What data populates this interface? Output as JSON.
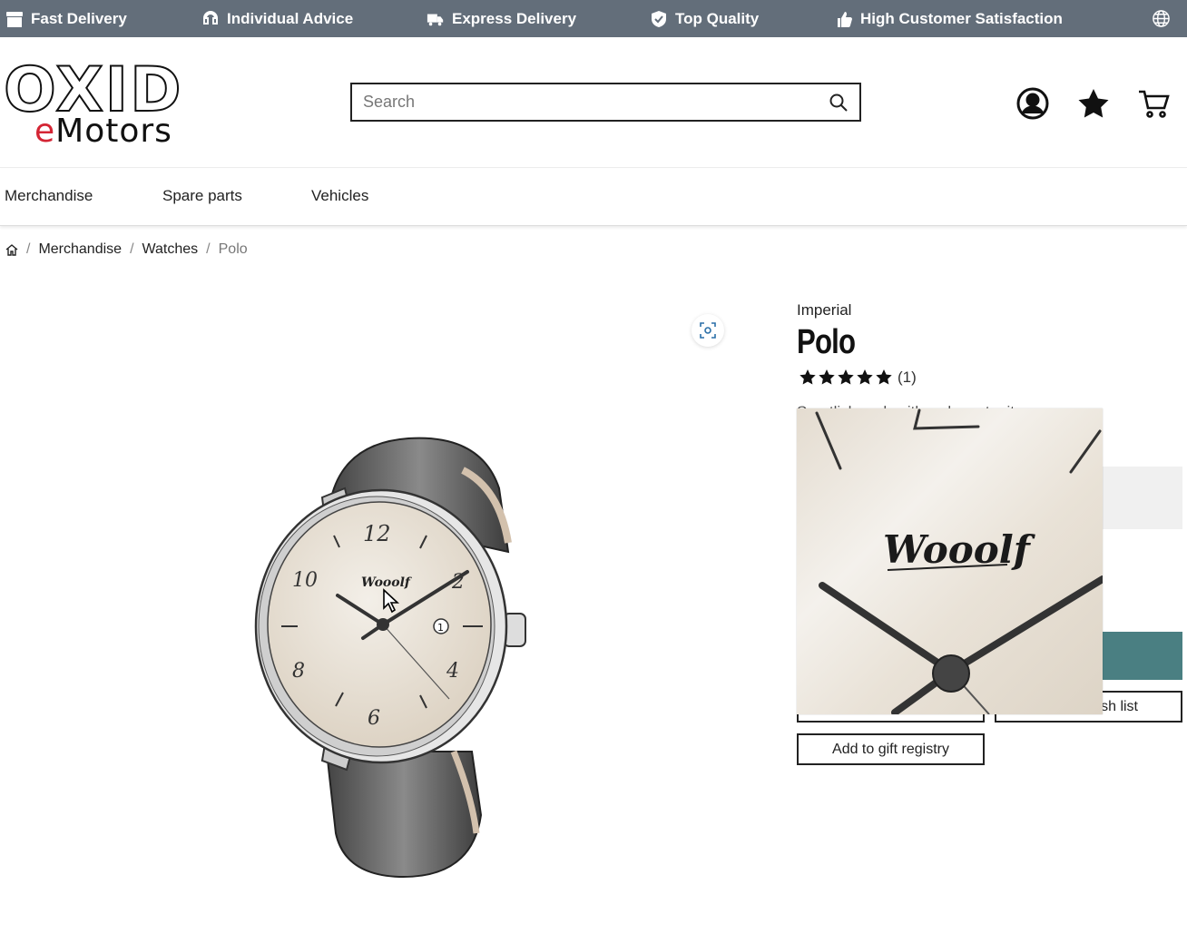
{
  "topbar": {
    "usps": [
      {
        "label": "Fast Delivery",
        "icon": "box-icon"
      },
      {
        "label": "Individual Advice",
        "icon": "headset-icon"
      },
      {
        "label": "Express Delivery",
        "icon": "truck-icon"
      },
      {
        "label": "Top Quality",
        "icon": "shield-check-icon"
      },
      {
        "label": "High Customer Satisfaction",
        "icon": "thumbs-up-icon"
      }
    ],
    "language_icon": "globe-icon"
  },
  "header": {
    "logo": {
      "line1": "OXID",
      "line2_accent": "e",
      "line2": "Motors"
    },
    "search": {
      "placeholder": "Search",
      "value": ""
    },
    "icons": [
      "account-icon",
      "wishlist-star-icon",
      "cart-icon"
    ]
  },
  "nav": {
    "items": [
      {
        "label": "Merchandise"
      },
      {
        "label": "Spare parts"
      },
      {
        "label": "Vehicles"
      }
    ]
  },
  "breadcrumb": {
    "items": [
      "Merchandise",
      "Watches"
    ],
    "current": "Polo"
  },
  "product": {
    "manufacturer": "Imperial",
    "title": "Polo",
    "rating": 5,
    "rating_count": "(1)",
    "short_description": "Sportlich und zeitlos elegant mit",
    "dial_text": "Wooolf",
    "buttons": {
      "compare": "",
      "wishlist": "sh list",
      "gift_registry": "Add to gift registry"
    }
  },
  "colors": {
    "topbar_bg": "#636e7a",
    "accent_red": "#d42534",
    "buy_button": "#4a7f82"
  }
}
